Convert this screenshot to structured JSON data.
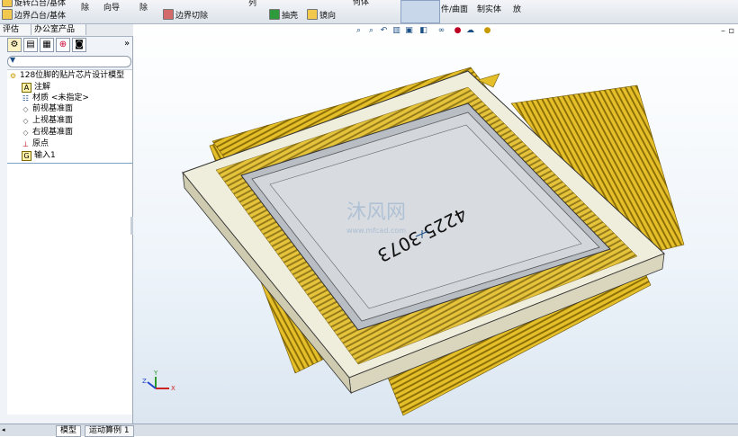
{
  "toolbar": {
    "items": [
      {
        "label": "旋转凸台/基体"
      },
      {
        "label": "边界凸台/基体"
      },
      {
        "label": "除"
      },
      {
        "label": "向导"
      },
      {
        "label": "除"
      },
      {
        "label": "边界切除"
      },
      {
        "label": "列"
      },
      {
        "label": "抽壳"
      },
      {
        "label": "镜向"
      },
      {
        "label": "何体"
      },
      {
        "label": "件/曲面"
      },
      {
        "label": "制实体"
      },
      {
        "label": "放"
      }
    ]
  },
  "panel_tabs": [
    "评估",
    "办公室产品"
  ],
  "tree": {
    "root": "128位脚的贴片芯片设计模型",
    "items": [
      {
        "label": "注解",
        "icon": "annotation-icon"
      },
      {
        "label": "材质 <未指定>",
        "icon": "material-icon"
      },
      {
        "label": "前视基准面",
        "icon": "plane-icon"
      },
      {
        "label": "上视基准面",
        "icon": "plane-icon"
      },
      {
        "label": "右视基准面",
        "icon": "plane-icon"
      },
      {
        "label": "原点",
        "icon": "origin-icon"
      },
      {
        "label": "输入1",
        "icon": "import-icon"
      }
    ]
  },
  "model": {
    "marking": "4225 3073",
    "watermark": "沐风网",
    "watermark_url": "www.mfcad.com"
  },
  "bottom_tabs": [
    "模型",
    "运动算例 1"
  ],
  "colors": {
    "pins": "#d9b21c",
    "pins_dark": "#8a6d05",
    "body": "#efeddb",
    "die": "#cfd3d8",
    "accent": "#1c4f86"
  }
}
